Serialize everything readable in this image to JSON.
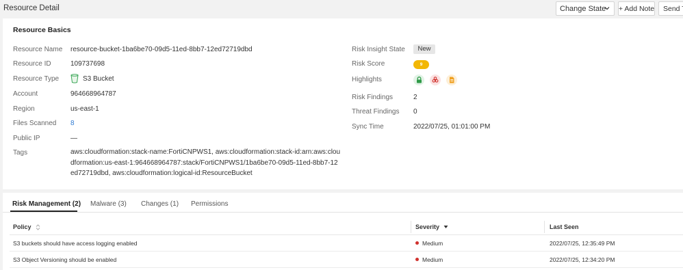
{
  "header": {
    "title": "Resource Detail",
    "change_state_label": "Change State",
    "add_note_label": "+ Add Note",
    "send_to_label": "Send To"
  },
  "basics": {
    "section_title": "Resource Basics",
    "labels": {
      "name": "Resource Name",
      "id": "Resource ID",
      "type": "Resource Type",
      "account": "Account",
      "region": "Region",
      "files_scanned": "Files Scanned",
      "public_ip": "Public IP",
      "tags": "Tags"
    },
    "values": {
      "name": "resource-bucket-1ba6be70-09d5-11ed-8bb7-12ed72719dbd",
      "id": "109737698",
      "type": "S3 Bucket",
      "type_icon": "s3-bucket-icon",
      "account": "964668964787",
      "region": "us-east-1",
      "files_scanned": "8",
      "public_ip": "—",
      "tags": "aws:cloudformation:stack-name:FortiCNPWS1, aws:cloudformation:stack-id:arn:aws:cloudformation:us-east-1:964668964787:stack/FortiCNPWS1/1ba6be70-09d5-11ed-8bb7-12ed72719dbd, aws:cloudformation:logical-id:ResourceBucket"
    }
  },
  "risk": {
    "labels": {
      "insight_state": "Risk Insight State",
      "score": "Risk Score",
      "highlights": "Highlights",
      "risk_findings": "Risk Findings",
      "threat_findings": "Threat Findings",
      "sync_time": "Sync Time"
    },
    "values": {
      "insight_state": "New",
      "score": "9",
      "highlights": [
        "lock-icon",
        "biohazard-icon",
        "document-icon"
      ],
      "risk_findings": "2",
      "threat_findings": "0",
      "sync_time": "2022/07/25, 01:01:00 PM"
    },
    "colors": {
      "score_badge": "#f2b705",
      "link": "#2f7bd2",
      "severity_medium": "#d0312d"
    }
  },
  "tabs": [
    {
      "label": "Risk Management (2)",
      "active": true
    },
    {
      "label": "Malware (3)",
      "active": false
    },
    {
      "label": "Changes (1)",
      "active": false
    },
    {
      "label": "Permissions",
      "active": false
    }
  ],
  "table": {
    "columns": [
      "Policy",
      "Severity",
      "Last Seen"
    ],
    "rows": [
      {
        "policy": "S3 buckets should have access logging enabled",
        "severity": "Medium",
        "last_seen": "2022/07/25, 12:35:49 PM"
      },
      {
        "policy": "S3 Object Versioning should be enabled",
        "severity": "Medium",
        "last_seen": "2022/07/25, 12:34:20 PM"
      }
    ]
  }
}
